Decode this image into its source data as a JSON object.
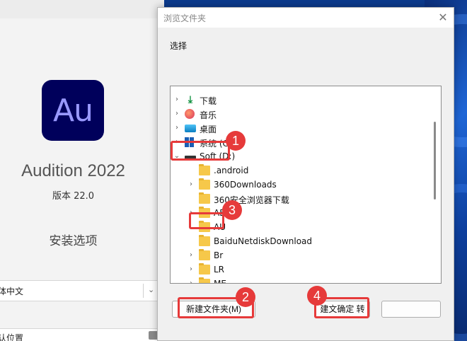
{
  "installer": {
    "logo_text": "Au",
    "app_name": "Audition 2022",
    "version": "版本 22.0",
    "install_options": "安装选项",
    "language_value": "体中文",
    "location_value": "认位置"
  },
  "dialog": {
    "title": "浏览文件夹",
    "close_glyph": "✕",
    "prompt": "选择",
    "tree": [
      {
        "label": "下载",
        "icon": "download-icon",
        "expand": "collapsed"
      },
      {
        "label": "音乐",
        "icon": "music-icon",
        "expand": "collapsed"
      },
      {
        "label": "桌面",
        "icon": "desktop-icon",
        "expand": "collapsed"
      },
      {
        "label": "系统 (C",
        "icon": "system-drive-icon",
        "expand": "collapsed"
      },
      {
        "label": "Soft (D:)",
        "icon": "drive-icon",
        "expand": "expanded"
      },
      {
        "label": ".android",
        "icon": "folder-icon",
        "expand": "none"
      },
      {
        "label": "360Downloads",
        "icon": "folder-icon",
        "expand": "collapsed"
      },
      {
        "label": "360安全浏览器下载",
        "icon": "folder-icon",
        "expand": "none"
      },
      {
        "label": "AE",
        "icon": "folder-icon",
        "expand": "collapsed"
      },
      {
        "label": "AU",
        "icon": "folder-icon",
        "expand": "none"
      },
      {
        "label": "BaiduNetdiskDownload",
        "icon": "folder-icon",
        "expand": "none"
      },
      {
        "label": "Br",
        "icon": "folder-icon",
        "expand": "collapsed"
      },
      {
        "label": "LR",
        "icon": "folder-icon",
        "expand": "collapsed"
      },
      {
        "label": "ME",
        "icon": "folder-icon",
        "expand": "collapsed"
      }
    ],
    "new_folder_button": "新建文件夹(M)",
    "ok_button": "建文确定 转",
    "cancel_button": ""
  },
  "annotations": {
    "badge_1": "1",
    "badge_2": "2",
    "badge_3": "3",
    "badge_4": "4",
    "color": "#e63a3a"
  },
  "chevrons": {
    "collapsed": "›",
    "expanded": "⌄"
  }
}
